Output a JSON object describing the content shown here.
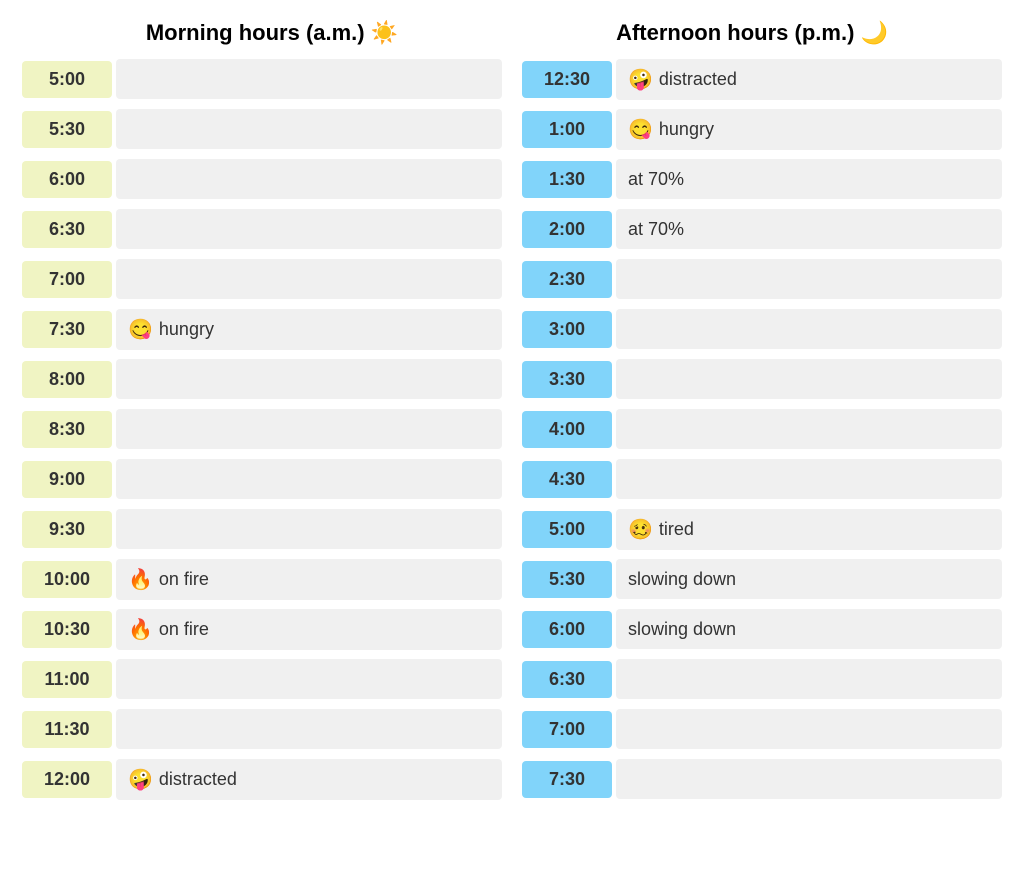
{
  "headers": {
    "morning": "Morning hours (a.m.) ☀️",
    "afternoon": "Afternoon hours (p.m.) 🌙"
  },
  "morning_rows": [
    {
      "time": "5:00",
      "status": "",
      "emoji": ""
    },
    {
      "time": "5:30",
      "status": "",
      "emoji": ""
    },
    {
      "time": "6:00",
      "status": "",
      "emoji": ""
    },
    {
      "time": "6:30",
      "status": "",
      "emoji": ""
    },
    {
      "time": "7:00",
      "status": "",
      "emoji": ""
    },
    {
      "time": "7:30",
      "status": "hungry",
      "emoji": "😋"
    },
    {
      "time": "8:00",
      "status": "",
      "emoji": ""
    },
    {
      "time": "8:30",
      "status": "",
      "emoji": ""
    },
    {
      "time": "9:00",
      "status": "",
      "emoji": ""
    },
    {
      "time": "9:30",
      "status": "",
      "emoji": ""
    },
    {
      "time": "10:00",
      "status": "on fire",
      "emoji": "🔥"
    },
    {
      "time": "10:30",
      "status": "on fire",
      "emoji": "🔥"
    },
    {
      "time": "11:00",
      "status": "",
      "emoji": ""
    },
    {
      "time": "11:30",
      "status": "",
      "emoji": ""
    },
    {
      "time": "12:00",
      "status": "distracted",
      "emoji": "🤪"
    }
  ],
  "afternoon_rows": [
    {
      "time": "12:30",
      "status": "distracted",
      "emoji": "🤪"
    },
    {
      "time": "1:00",
      "status": "hungry",
      "emoji": "😋"
    },
    {
      "time": "1:30",
      "status": "at 70%",
      "emoji": ""
    },
    {
      "time": "2:00",
      "status": "at 70%",
      "emoji": ""
    },
    {
      "time": "2:30",
      "status": "",
      "emoji": ""
    },
    {
      "time": "3:00",
      "status": "",
      "emoji": ""
    },
    {
      "time": "3:30",
      "status": "",
      "emoji": ""
    },
    {
      "time": "4:00",
      "status": "",
      "emoji": ""
    },
    {
      "time": "4:30",
      "status": "",
      "emoji": ""
    },
    {
      "time": "5:00",
      "status": "tired",
      "emoji": "🥴"
    },
    {
      "time": "5:30",
      "status": "slowing down",
      "emoji": ""
    },
    {
      "time": "6:00",
      "status": "slowing down",
      "emoji": ""
    },
    {
      "time": "6:30",
      "status": "",
      "emoji": ""
    },
    {
      "time": "7:00",
      "status": "",
      "emoji": ""
    },
    {
      "time": "7:30",
      "status": "",
      "emoji": ""
    }
  ]
}
